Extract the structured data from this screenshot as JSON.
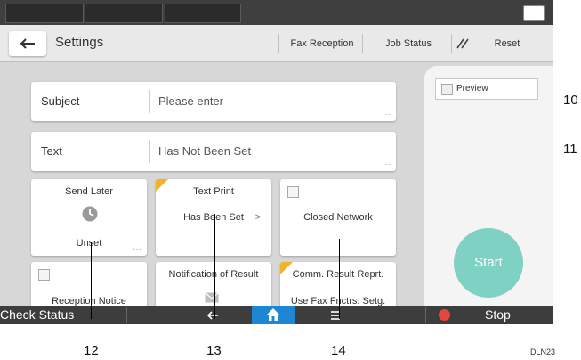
{
  "header": {
    "title": "Settings",
    "buttons": [
      "Fax Reception",
      "Job Status",
      "Reset"
    ]
  },
  "fields": [
    {
      "label": "Subject",
      "value": "Please enter"
    },
    {
      "label": "Text",
      "value": "Has Not Been Set"
    }
  ],
  "tiles": {
    "send_later": {
      "title": "Send Later",
      "status": "Unset"
    },
    "text_print": {
      "title": "Text Print",
      "status": "Has Been Set"
    },
    "closed_network": {
      "title": "Closed Network"
    },
    "reception_notice": {
      "title": "Reception Notice"
    },
    "notification": {
      "title": "Notification of Result"
    },
    "comm_result": {
      "title": "Comm. Result Reprt.",
      "status": "Use Fax Fnctrs. Setg."
    }
  },
  "preview": {
    "label": "Preview"
  },
  "start": {
    "label": "Start"
  },
  "bottom": {
    "check_status": "Check Status",
    "stop": "Stop"
  },
  "callouts": [
    "10",
    "11",
    "12",
    "13",
    "14"
  ],
  "figure_id": "DLN23",
  "colors": {
    "start": "#7fd1c4",
    "home": "#1f86d4",
    "stop": "#e2483d",
    "corner": "#f0b429"
  }
}
